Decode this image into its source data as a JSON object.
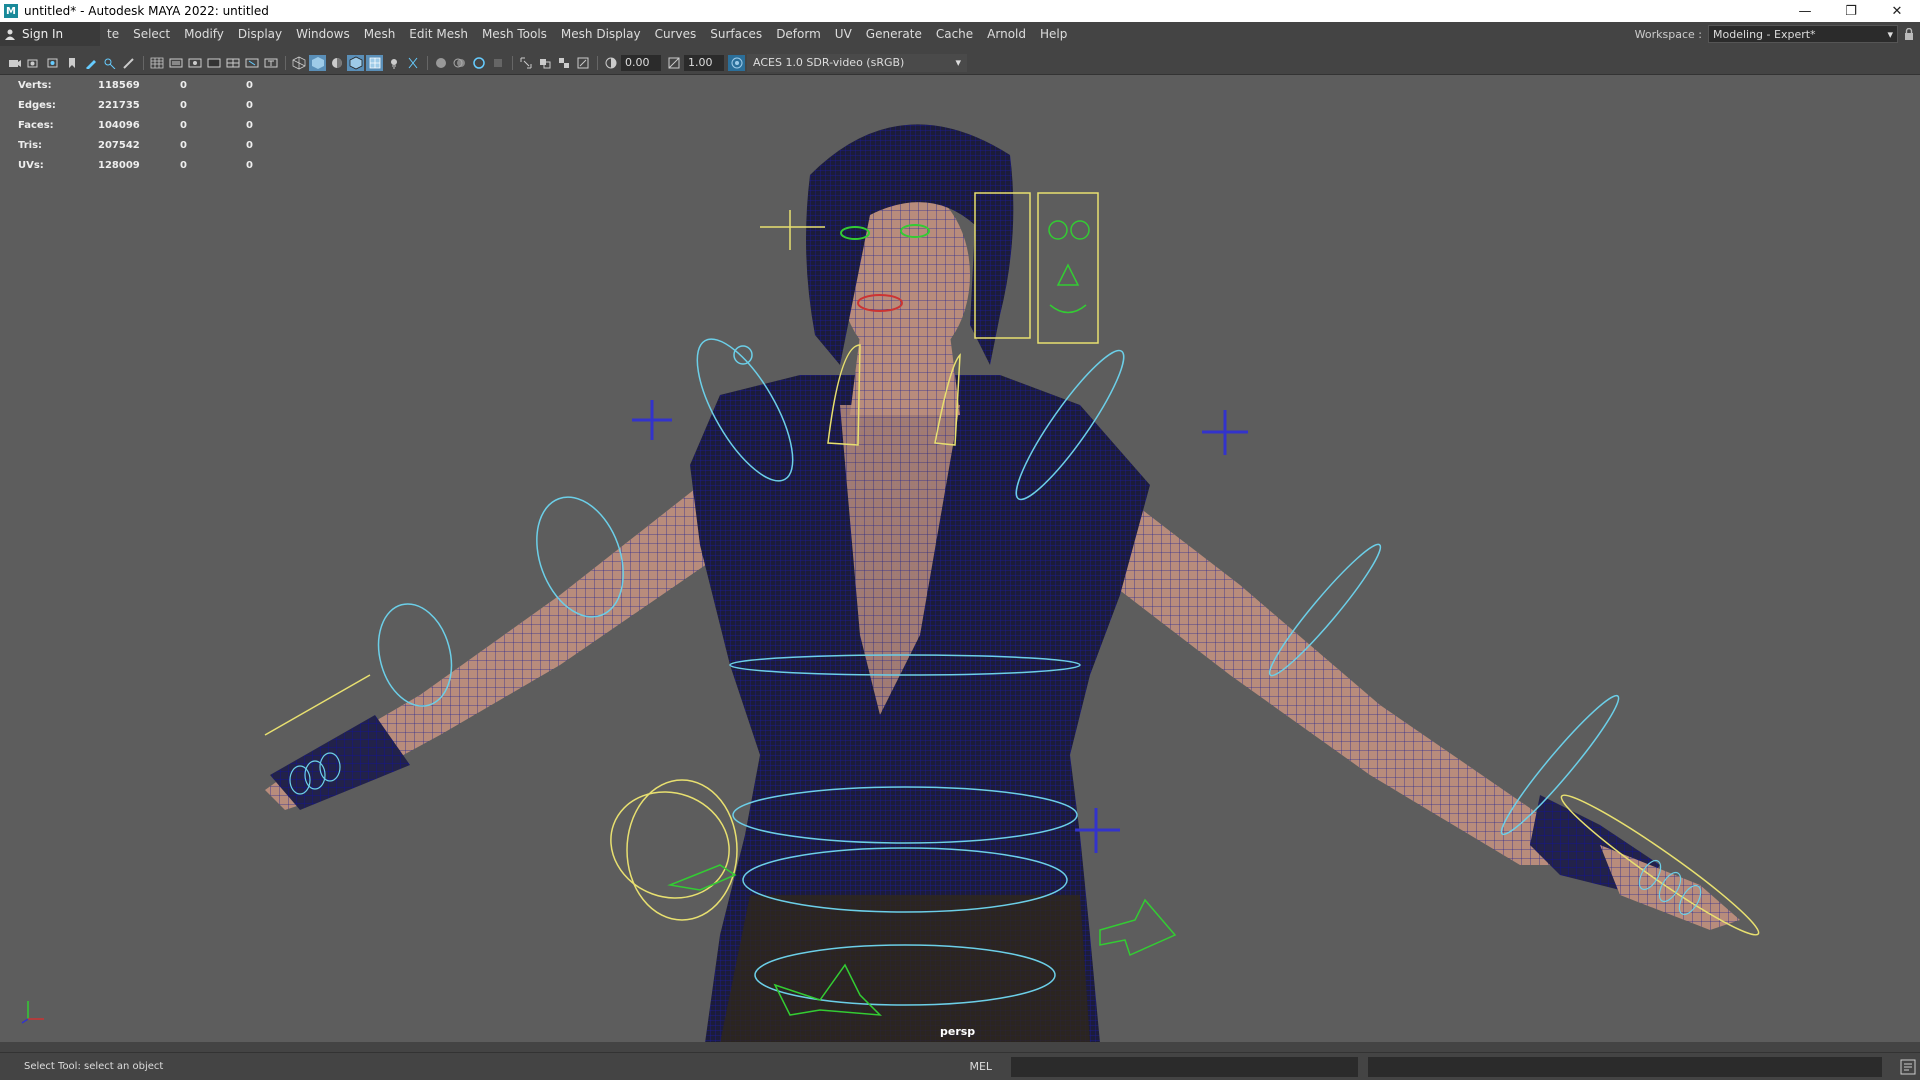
{
  "window": {
    "title": "untitled* - Autodesk MAYA 2022: untitled",
    "logo": "M",
    "controls": [
      "minimize-icon",
      "restore-icon",
      "close-icon"
    ]
  },
  "menubar": {
    "sign_in": "Sign In",
    "items": [
      "te",
      "Select",
      "Modify",
      "Display",
      "Windows",
      "Mesh",
      "Edit Mesh",
      "Mesh Tools",
      "Mesh Display",
      "Curves",
      "Surfaces",
      "Deform",
      "UV",
      "Generate",
      "Cache",
      "Arnold",
      "Help"
    ],
    "workspace_label": "Workspace :",
    "workspace_value": "Modeling - Expert*"
  },
  "toolbar": {
    "field_a": "0.00",
    "field_b": "1.00",
    "color_space": "ACES 1.0 SDR-video (sRGB)"
  },
  "hud": {
    "rows": [
      {
        "label": "Verts:",
        "value": "118569",
        "sel": "0",
        "comp": "0"
      },
      {
        "label": "Edges:",
        "value": "221735",
        "sel": "0",
        "comp": "0"
      },
      {
        "label": "Faces:",
        "value": "104096",
        "sel": "0",
        "comp": "0"
      },
      {
        "label": "Tris:",
        "value": "207542",
        "sel": "0",
        "comp": "0"
      },
      {
        "label": "UVs:",
        "value": "128009",
        "sel": "0",
        "comp": "0"
      }
    ]
  },
  "viewport": {
    "camera": "persp",
    "background": "#5d5d5d",
    "wire_color": "#14148c",
    "skin_color": "#b88c7c",
    "ctrl_yellow": "#e8e070",
    "ctrl_cyan": "#6ccfe8",
    "ctrl_green": "#33cc33",
    "ctrl_blue": "#3333cc"
  },
  "status": {
    "text": "Select Tool: select an object",
    "mel": "MEL"
  }
}
